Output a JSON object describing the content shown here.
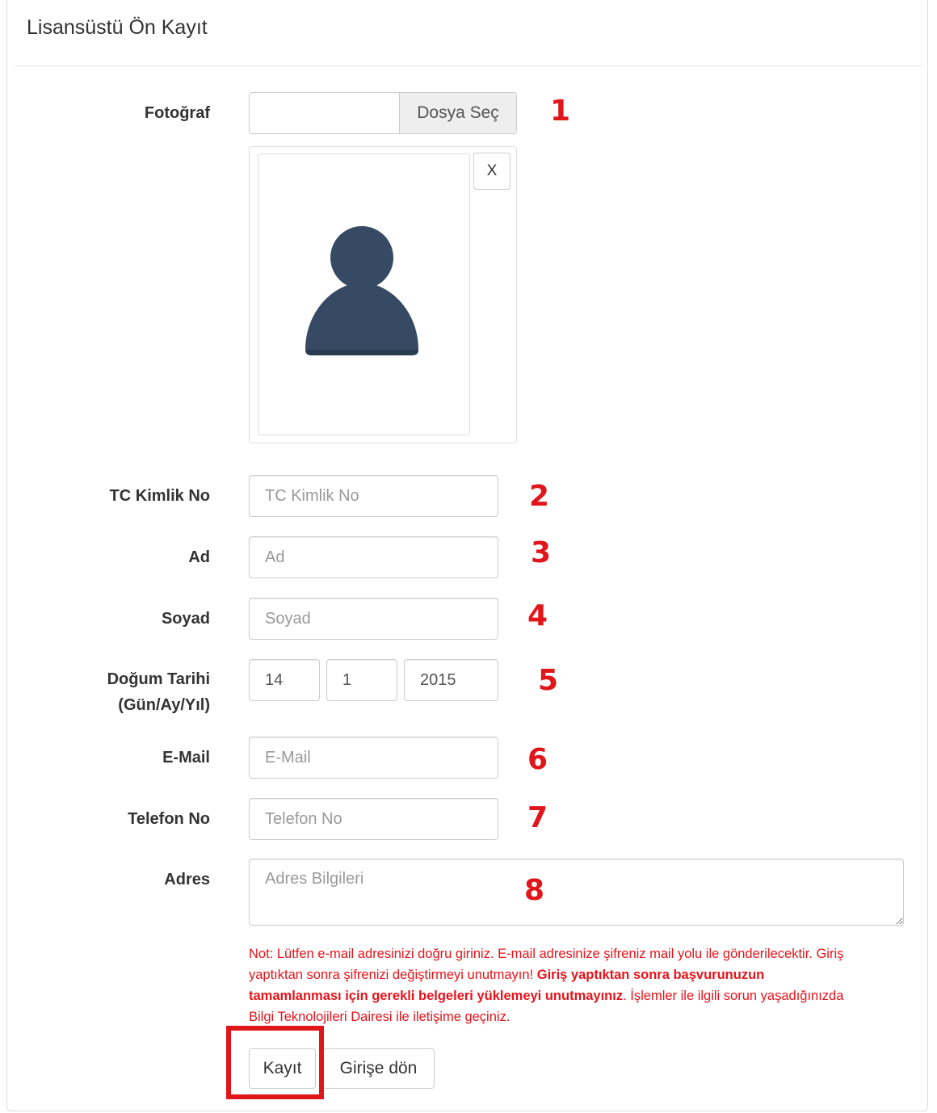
{
  "panel": {
    "title": "Lisansüstü Ön Kayıt"
  },
  "form": {
    "photo": {
      "label": "Fotoğraf",
      "file_button": "Dosya Seç",
      "remove_label": "X"
    },
    "tc": {
      "label": "TC Kimlik No",
      "placeholder": "TC Kimlik No",
      "value": ""
    },
    "ad": {
      "label": "Ad",
      "placeholder": "Ad",
      "value": ""
    },
    "soyad": {
      "label": "Soyad",
      "placeholder": "Soyad",
      "value": ""
    },
    "dogum": {
      "label_line1": "Doğum Tarihi",
      "label_line2": "(Gün/Ay/Yıl)",
      "day": "14",
      "month": "1",
      "year": "2015"
    },
    "email": {
      "label": "E-Mail",
      "placeholder": "E-Mail",
      "value": ""
    },
    "telefon": {
      "label": "Telefon No",
      "placeholder": "Telefon No",
      "value": ""
    },
    "adres": {
      "label": "Adres",
      "placeholder": "Adres Bilgileri",
      "value": ""
    }
  },
  "note": {
    "part1": "Not: Lütfen e-mail adresinizi doğru giriniz. E-mail adresinize şifreniz mail yolu ile gönderilecektir. Giriş yaptıktan sonra şifrenizi değiştirmeyi unutmayın! ",
    "bold": "Giriş yaptıktan sonra başvurunuzun tamamlanması için gerekli belgeleri yüklemeyi unutmayınız",
    "part2": ". İşlemler ile ilgili sorun yaşadığınızda Bilgi Teknolojileri Dairesi ile iletişime geçiniz."
  },
  "buttons": {
    "kayit": "Kayıt",
    "girise_don": "Girişe dön"
  },
  "annotations": [
    "1",
    "2",
    "3",
    "4",
    "5",
    "6",
    "7",
    "8"
  ],
  "colors": {
    "annotation_red": "#e0161b",
    "note_red": "#e8131a",
    "avatar": "#364a63"
  }
}
